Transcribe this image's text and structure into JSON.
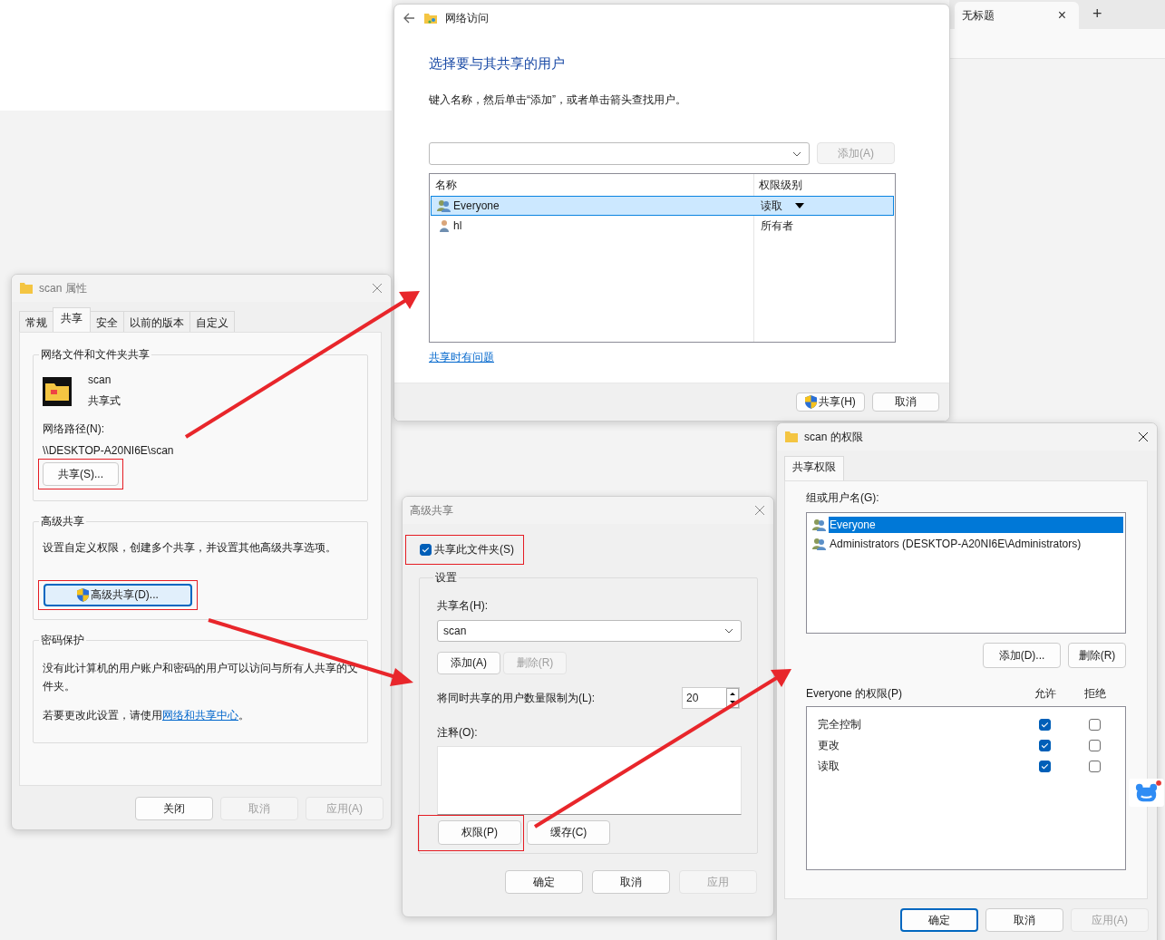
{
  "browser": {
    "tab_title": "无标题",
    "tab_close": "×",
    "new_tab": "+"
  },
  "network_access": {
    "title": "网络访问",
    "heading": "选择要与其共享的用户",
    "instruction": "键入名称，然后单击“添加”，或者单击箭头查找用户。",
    "add_button": {
      "label": "添加(A)",
      "disabled": true
    },
    "columns": [
      "名称",
      "权限级别"
    ],
    "users": [
      {
        "name": "Everyone",
        "permission": "读取",
        "selected": true,
        "kind": "group"
      },
      {
        "name": "hl",
        "permission": "所有者",
        "selected": false,
        "kind": "user"
      }
    ],
    "help_link": "共享时有问题",
    "buttons": [
      {
        "label": "共享(H)",
        "shield": true
      },
      {
        "label": "取消",
        "shield": false
      }
    ]
  },
  "properties": {
    "title": "scan 属性",
    "tabs": [
      {
        "label": "常规",
        "selected": false
      },
      {
        "label": "共享",
        "selected": true
      },
      {
        "label": "安全",
        "selected": false
      },
      {
        "label": "以前的版本",
        "selected": false
      },
      {
        "label": "自定义",
        "selected": false
      }
    ],
    "network_group": {
      "title": "网络文件和文件夹共享",
      "folder_name": "scan",
      "folder_state": "共享式",
      "path_label": "网络路径(N):",
      "path": "\\\\DESKTOP-A20NI6E\\scan",
      "share_button": {
        "label": "共享(S)...",
        "highlighted": true
      }
    },
    "advanced_group": {
      "title": "高级共享",
      "description": "设置自定义权限，创建多个共享，并设置其他高级共享选项。",
      "button": {
        "label": "高级共享(D)...",
        "highlighted": true
      }
    },
    "password_group": {
      "title": "密码保护",
      "description": "没有此计算机的用户账户和密码的用户可以访问与所有人共享的文件夹。",
      "change_text": "若要更改此设置，请使用",
      "link": "网络和共享中心",
      "end": "。"
    },
    "buttons": [
      {
        "label": "关闭",
        "disabled": false
      },
      {
        "label": "取消",
        "disabled": true
      },
      {
        "label": "应用(A)",
        "disabled": true
      }
    ]
  },
  "advanced_sharing": {
    "title": "高级共享",
    "share_checkbox": {
      "label": "共享此文件夹(S)",
      "checked": true,
      "highlighted": true
    },
    "settings_title": "设置",
    "share_name_label": "共享名(H):",
    "share_name": "scan",
    "add_button": {
      "label": "添加(A)",
      "disabled": false
    },
    "remove_button": {
      "label": "删除(R)",
      "disabled": true
    },
    "limit_label": "将同时共享的用户数量限制为(L):",
    "limit_value": "20",
    "comment_label": "注释(O):",
    "permissions_button": {
      "label": "权限(P)",
      "highlighted": true
    },
    "caching_button": {
      "label": "缓存(C)",
      "highlighted": false
    },
    "buttons": [
      {
        "label": "确定",
        "disabled": false
      },
      {
        "label": "取消",
        "disabled": false
      },
      {
        "label": "应用",
        "disabled": true
      }
    ]
  },
  "permissions": {
    "title": "scan 的权限",
    "tab": {
      "label": "共享权限",
      "selected": true
    },
    "group_label": "组或用户名(G):",
    "groups": [
      {
        "name": "Everyone",
        "selected": true
      },
      {
        "name": "Administrators (DESKTOP-A20NI6E\\Administrators)",
        "selected": false
      }
    ],
    "add_button": {
      "label": "添加(D)...",
      "disabled": false
    },
    "remove_button": {
      "label": "删除(R)",
      "disabled": false
    },
    "perm_label": "Everyone 的权限(P)",
    "allow_header": "允许",
    "deny_header": "拒绝",
    "rows": [
      {
        "name": "完全控制",
        "allow": true,
        "deny": false
      },
      {
        "name": "更改",
        "allow": true,
        "deny": false
      },
      {
        "name": "读取",
        "allow": true,
        "deny": false
      }
    ],
    "buttons": [
      {
        "label": "确定",
        "disabled": false,
        "default": true
      },
      {
        "label": "取消",
        "disabled": false,
        "default": false
      },
      {
        "label": "应用(A)",
        "disabled": true,
        "default": false
      }
    ]
  }
}
